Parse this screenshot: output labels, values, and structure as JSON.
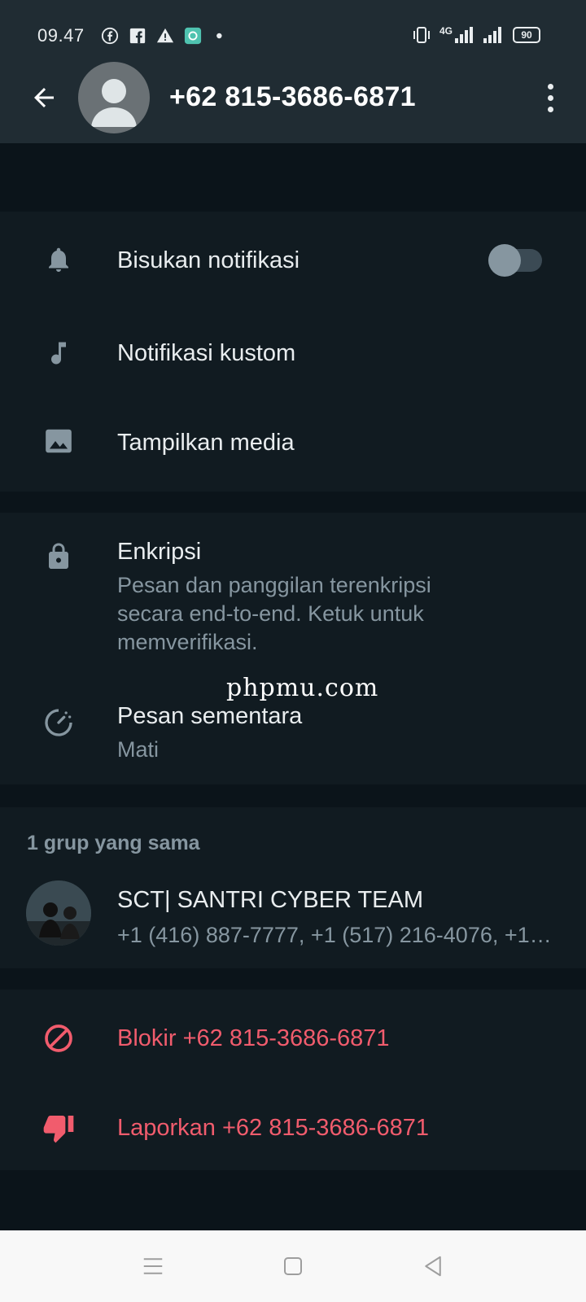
{
  "status_bar": {
    "time": "09.47",
    "icons": [
      "facebook-icon",
      "facebook-square-icon",
      "warning-icon",
      "app-notification-icon",
      "dot-icon"
    ],
    "network_label": "4G",
    "battery": "90"
  },
  "header": {
    "title": "+62 815-3686-6871"
  },
  "settings": {
    "mute_label": "Bisukan notifikasi",
    "mute_enabled": false,
    "custom_notif_label": "Notifikasi kustom",
    "media_label": "Tampilkan media"
  },
  "encryption": {
    "title": "Enkripsi",
    "description": "Pesan dan panggilan terenkripsi secara end-to-end. Ketuk untuk memverifikasi."
  },
  "disappearing": {
    "title": "Pesan sementara",
    "value": "Mati"
  },
  "groups": {
    "header": "1 grup yang sama",
    "items": [
      {
        "name": "SCT| SANTRI CYBER TEAM",
        "members": "+1 (416) 887-7777, +1 (517) 216-4076, +1…"
      }
    ]
  },
  "actions": {
    "block_label": "Blokir +62 815-3686-6871",
    "report_label": "Laporkan +62 815-3686-6871"
  },
  "watermark": "phpmu.com",
  "colors": {
    "appbar": "#202c33",
    "background": "#0b141a",
    "section": "#111b21",
    "danger": "#f15c6d",
    "secondary_text": "#8696a0"
  }
}
